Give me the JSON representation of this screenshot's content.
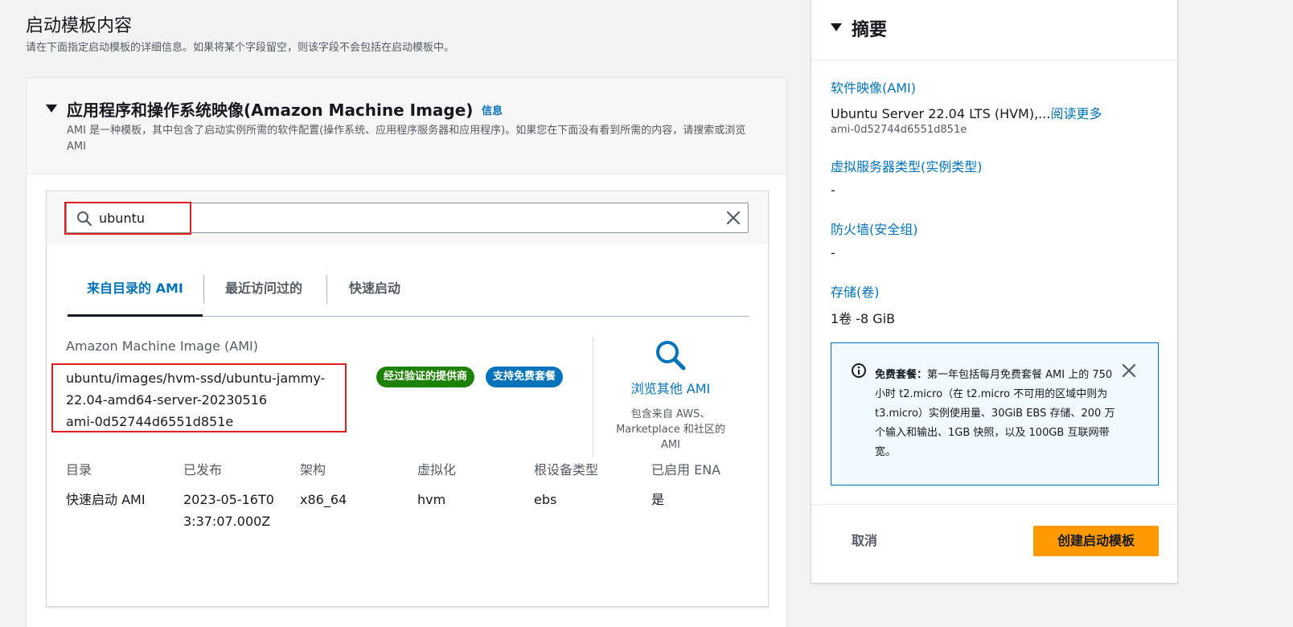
{
  "page": {
    "title": "启动模板内容",
    "description": "请在下面指定启动模板的详细信息。如果将某个字段留空，则该字段不会包括在启动模板中。"
  },
  "ami_section": {
    "title": "应用程序和操作系统映像(Amazon Machine Image)",
    "info_link": "信息",
    "description": "AMI 是一种模板，其中包含了启动实例所需的软件配置(操作系统、应用程序服务器和应用程序)。如果您在下面没有看到所需的内容，请搜索或浏览 AMI",
    "search": {
      "value": "ubuntu"
    },
    "tabs": [
      {
        "label": "来自目录的 AMI",
        "active": true
      },
      {
        "label": "最近访问过的",
        "active": false
      },
      {
        "label": "快速启动",
        "active": false
      }
    ],
    "ami_label": "Amazon Machine Image (AMI)",
    "ami_name": "ubuntu/images/hvm-ssd/ubuntu-jammy-22.04-amd64-server-20230516",
    "ami_id": "ami-0d52744d6551d851e",
    "badges": {
      "verified": "经过验证的提供商",
      "free_tier": "支持免费套餐"
    },
    "browse": {
      "link": "浏览其他 AMI",
      "description": "包含来自 AWS、Marketplace 和社区的 AMI"
    },
    "details": {
      "headers": [
        "目录",
        "已发布",
        "架构",
        "虚拟化",
        "根设备类型",
        "已启用 ENA"
      ],
      "values": [
        "快速启动 AMI",
        "2023-05-16T03:37:07.000Z",
        "x86_64",
        "hvm",
        "ebs",
        "是"
      ]
    }
  },
  "summary": {
    "title": "摘要",
    "software_image_label": "软件映像(AMI)",
    "software_image_value": "Ubuntu Server 22.04 LTS (HVM),...",
    "read_more": "阅读更多",
    "software_image_id": "ami-0d52744d6551d851e",
    "instance_type_label": "虚拟服务器类型(实例类型)",
    "instance_type_value": "-",
    "firewall_label": "防火墙(安全组)",
    "firewall_value": "-",
    "storage_label": "存储(卷)",
    "storage_value": "1卷 -8 GiB",
    "alert_title": "免费套餐：",
    "alert_body": "第一年包括每月免费套餐 AMI 上的 750 小时 t2.micro（在 t2.micro 不可用的区域中则为 t3.micro）实例使用量、30GiB EBS 存储、200 万个输入和输出、1GB 快照，以及 100GB 互联网带宽。",
    "cancel_label": "取消",
    "create_label": "创建启动模板"
  },
  "colors": {
    "link": "#0073bb",
    "verified_badge": "#1d8102",
    "free_badge": "#0073bb",
    "primary_button": "#ff9900",
    "highlight_box": "#e02020"
  }
}
